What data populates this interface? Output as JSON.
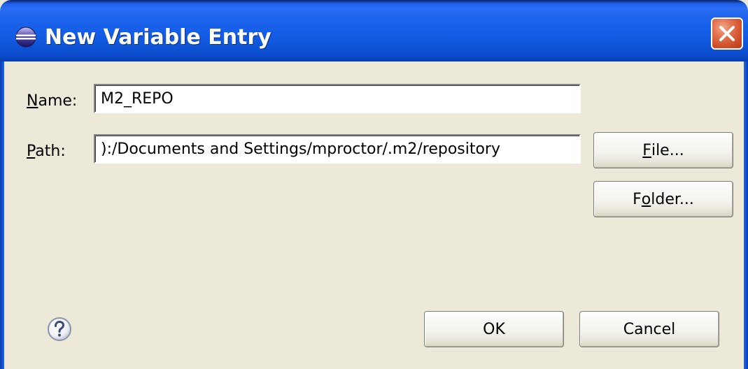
{
  "window": {
    "title": "New Variable Entry"
  },
  "form": {
    "name_label_mnemonic": "N",
    "name_label_rest": "ame:",
    "name_value": "M2_REPO",
    "path_label_mnemonic": "P",
    "path_label_rest": "ath:",
    "path_value": "):/Documents and Settings/mproctor/.m2/repository"
  },
  "buttons": {
    "file_mnemonic": "F",
    "file_rest": "ile...",
    "folder_prefix": "F",
    "folder_mnemonic": "o",
    "folder_rest": "lder...",
    "ok_label": "OK",
    "cancel_label": "Cancel"
  },
  "icons": {
    "window_icon": "eclipse-icon",
    "close_icon": "close-icon",
    "help_icon": "help-icon"
  }
}
